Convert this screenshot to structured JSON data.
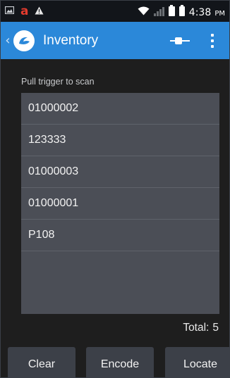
{
  "status_bar": {
    "time": "4:38",
    "ampm": "PM",
    "icons": [
      "gallery-icon",
      "amazon-icon",
      "warning-icon",
      "wifi-icon",
      "signal-icon",
      "sim-icon",
      "battery-icon"
    ],
    "amazon_glyph": "a"
  },
  "action_bar": {
    "title": "Inventory",
    "background": "#2b88d9"
  },
  "scan_hint": "Pull trigger to scan",
  "tags": [
    "01000002",
    "123333",
    "01000003",
    "01000001",
    "P108"
  ],
  "total": {
    "label": "Total:",
    "count": "5"
  },
  "buttons": {
    "clear": "Clear",
    "encode": "Encode",
    "locate": "Locate"
  }
}
